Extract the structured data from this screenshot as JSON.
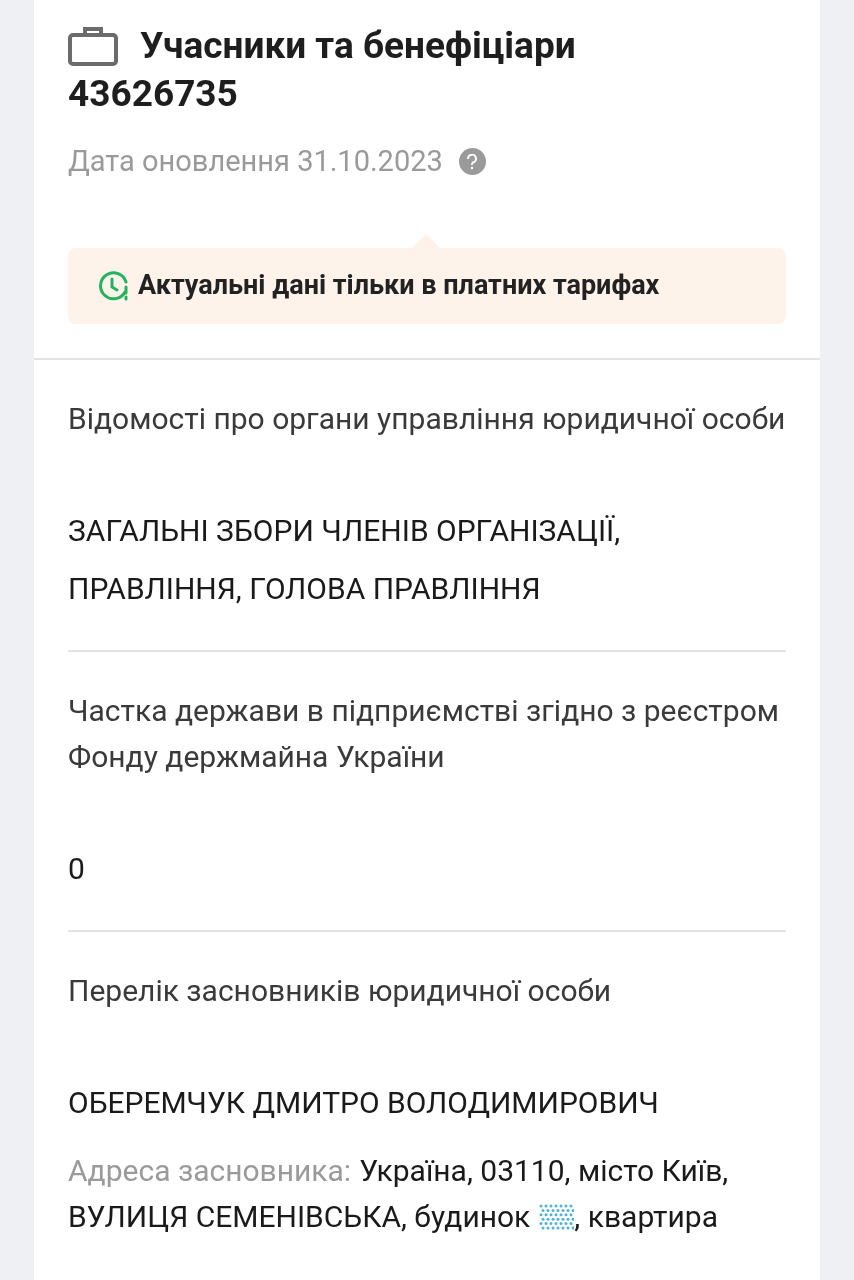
{
  "header": {
    "title": "Учасники та бенефіціари",
    "code": "43626735",
    "updated": "Дата оновлення 31.10.2023"
  },
  "notice": {
    "text": "Актуальні дані тільки в платних тарифах"
  },
  "sections": [
    {
      "label": "Відомості про органи управління юридичної особи",
      "value": "ЗАГАЛЬНІ ЗБОРИ ЧЛЕНІВ ОРГАНІЗАЦІЇ, ПРАВЛІННЯ, ГОЛОВА ПРАВЛІННЯ"
    },
    {
      "label": "Частка держави в підприємстві згідно з реєстром Фонду держмайна України",
      "value": "0"
    },
    {
      "label": "Перелік засновників юридичної особи",
      "value": "ОБЕРЕМЧУК ДМИТРО ВОЛОДИМИРОВИЧ",
      "address": {
        "label": "Адреса засновника:",
        "line_1": "Україна, 03110, місто Київ,",
        "line_2_before": "ВУЛИЦЯ СЕМЕНІВСЬКА, будинок",
        "line_2_after": ", квартира"
      }
    }
  ]
}
